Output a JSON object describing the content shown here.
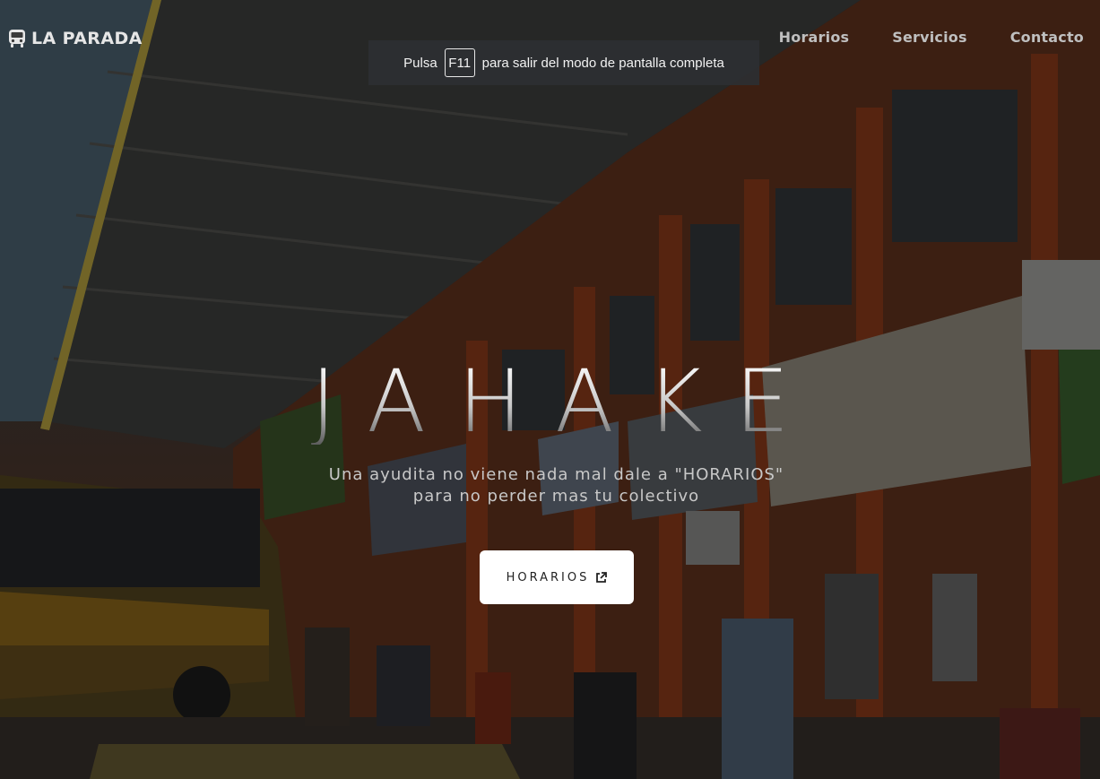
{
  "header": {
    "brand_label": "LA PARADA",
    "brand_icon": "bus-icon",
    "nav_items": [
      {
        "label": "Horarios"
      },
      {
        "label": "Servicios"
      },
      {
        "label": "Contacto"
      }
    ]
  },
  "fullscreen_notice": {
    "prefix": "Pulsa",
    "key": "F11",
    "suffix": "para salir del modo de pantalla completa"
  },
  "hero": {
    "title": "JAHAKE",
    "subtitle": "Una ayudita no viene nada mal dale a \"HORARIOS\" para no perder mas tu colectivo",
    "button_label": "HORARIOS",
    "button_icon": "external-link-icon"
  }
}
